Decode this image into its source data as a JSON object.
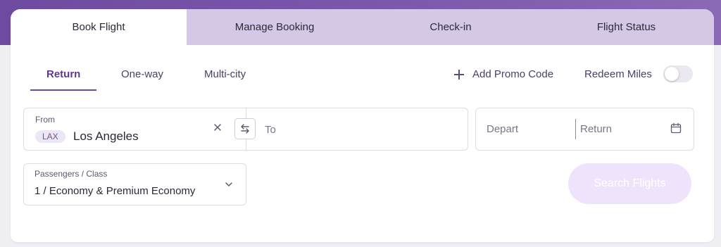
{
  "tabs": [
    {
      "label": "Book Flight"
    },
    {
      "label": "Manage Booking"
    },
    {
      "label": "Check-in"
    },
    {
      "label": "Flight Status"
    }
  ],
  "trip_types": [
    {
      "label": "Return",
      "active": true
    },
    {
      "label": "One-way",
      "active": false
    },
    {
      "label": "Multi-city",
      "active": false
    }
  ],
  "promo": {
    "label": "Add Promo Code",
    "icon": "plus-icon"
  },
  "miles": {
    "label": "Redeem Miles",
    "enabled": false
  },
  "from": {
    "label": "From",
    "code": "LAX",
    "city": "Los Angeles"
  },
  "to": {
    "placeholder": "To"
  },
  "dates": {
    "depart_placeholder": "Depart",
    "return_placeholder": "Return",
    "icon": "calendar-icon"
  },
  "passengers": {
    "label": "Passengers / Class",
    "value": "1 / Economy & Premium Economy"
  },
  "search": {
    "label": "Search Flights"
  },
  "colors": {
    "brand_purple": "#6e4ba1",
    "tab_inactive": "#d5c8e6",
    "button_disabled": "#efe3fb"
  }
}
